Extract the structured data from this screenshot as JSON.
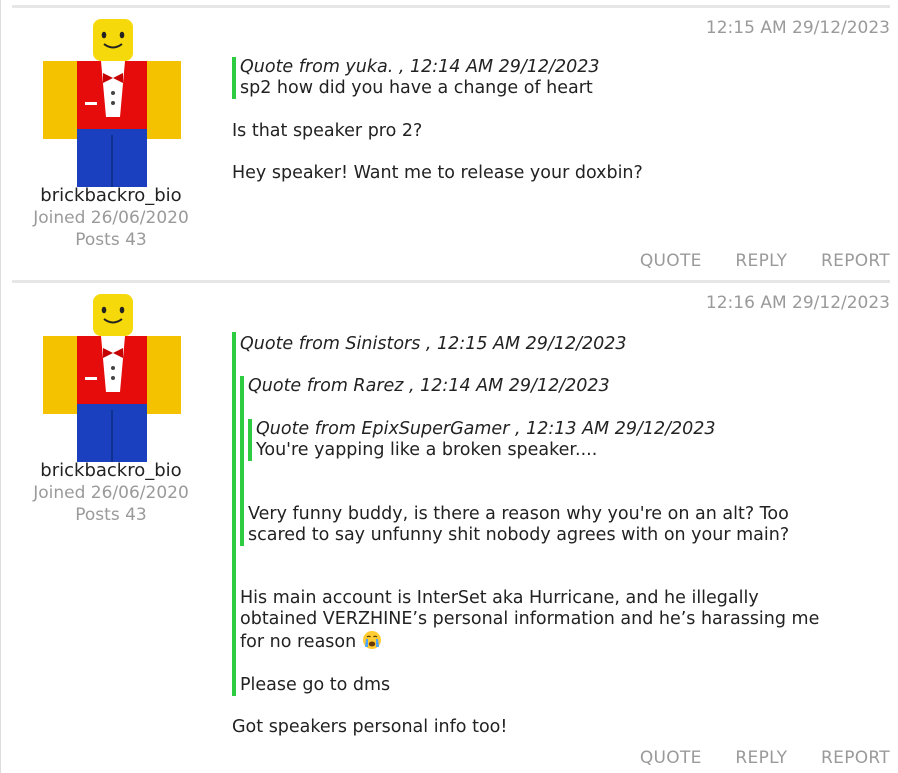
{
  "posts": [
    {
      "timestamp": "12:15 AM 29/12/2023",
      "author": {
        "username": "brickbackro_bio",
        "joined": "Joined 26/06/2020",
        "posts": "Posts 43"
      },
      "quote": {
        "header": "Quote from yuka. , 12:14 AM 29/12/2023",
        "text": "sp2 how did you have a change of heart"
      },
      "paragraphs": [
        "Is that speaker pro 2?",
        "Hey speaker! Want me to release your doxbin?"
      ],
      "actions": {
        "quote": "QUOTE",
        "reply": "REPLY",
        "report": "REPORT"
      }
    },
    {
      "timestamp": "12:16 AM 29/12/2023",
      "author": {
        "username": "brickbackro_bio",
        "joined": "Joined 26/06/2020",
        "posts": "Posts 43"
      },
      "quote": {
        "header": "Quote from Sinistors , 12:15 AM 29/12/2023",
        "quote": {
          "header": "Quote from Rarez , 12:14 AM 29/12/2023",
          "quote": {
            "header": "Quote from EpixSuperGamer , 12:13 AM 29/12/2023",
            "text": "You're yapping like a broken speaker...."
          },
          "text": "Very funny buddy, is there a reason why you're on an alt? Too scared to say unfunny shit nobody agrees with on your main?"
        },
        "text1": "His main account is InterSet aka Hurricane, and he illegally obtained VERZHINE’s personal information and he’s harassing me for no reason",
        "text2": "Please go to dms"
      },
      "paragraphs": [
        "Got speakers personal info too!"
      ],
      "actions": {
        "quote": "QUOTE",
        "reply": "REPLY",
        "report": "REPORT"
      }
    }
  ],
  "colors": {
    "quote_bar": "#2ecc40",
    "muted": "#9a9a9a"
  },
  "icons": {
    "avatar": "roblox-avatar-icon",
    "emoji": "crying-face-emoji-icon"
  }
}
